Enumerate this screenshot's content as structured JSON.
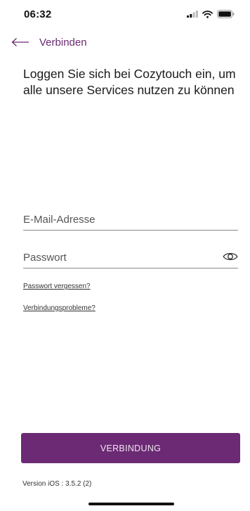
{
  "status_bar": {
    "time": "06:32",
    "icons": [
      "signal-icon",
      "wifi-icon",
      "battery-icon"
    ]
  },
  "nav": {
    "back_icon": "arrow-left-icon",
    "title": "Verbinden"
  },
  "headline": "Loggen Sie sich bei Cozytouch ein, um alle unsere Services nutzen zu können",
  "form": {
    "email_placeholder": "E-Mail-Adresse",
    "email_value": "",
    "password_placeholder": "Passwort",
    "password_value": "",
    "password_toggle_icon": "eye-icon"
  },
  "links": {
    "forgot_password": "Passwort vergessen?",
    "connection_problems": "Verbindungsprobleme?"
  },
  "connect_button_label": "VERBINDUNG",
  "version": "Version iOS : 3.5.2 (2)",
  "colors": {
    "brand": "#6b2a73",
    "button_text": "#f1e6f3",
    "background": "#ffffff"
  }
}
